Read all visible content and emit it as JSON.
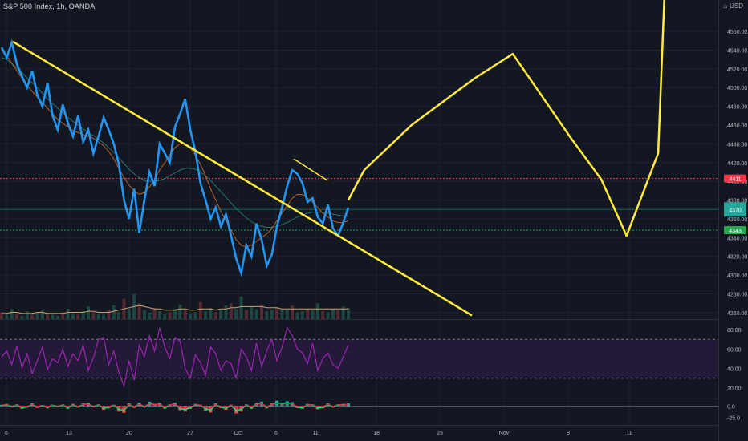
{
  "header": {
    "symbol_title": "S&P 500 Index, 1h, OANDA",
    "currency": "USD"
  },
  "colors": {
    "background": "#131722",
    "grid": "#1e222d",
    "axis_text": "#b2b5be",
    "price_line": "#2196f3",
    "trendline": "#ffeb3b",
    "projection": "#ffeb3b",
    "resistance": "#f23645",
    "support": "#22ab4d",
    "current_price": "#26a69a",
    "rsi_line": "#9c27b0",
    "rsi_band": "#311b4a",
    "volume_ma": "#c8a36a"
  },
  "chart_data": [
    {
      "type": "line",
      "pane": "price",
      "title": "",
      "ylim": [
        4250,
        4590
      ],
      "y_ticks": [
        4260,
        4280,
        4300,
        4320,
        4340,
        4360,
        4380,
        4400,
        4420,
        4440,
        4460,
        4480,
        4500,
        4520,
        4540,
        4560
      ],
      "x_ticks": [
        "6",
        "13",
        "20",
        "27",
        "Oct",
        "6",
        "11",
        "18",
        "25",
        "Nov",
        "8",
        "11"
      ],
      "grid": true,
      "price_labels": [
        {
          "label": "4411",
          "value": 4403,
          "kind": "resistance"
        },
        {
          "label": "4370",
          "value": 4370,
          "kind": "current"
        },
        {
          "label": "4343",
          "value": 4348,
          "kind": "support"
        }
      ],
      "series": [
        {
          "role": "price",
          "values": [
            4543,
            4532,
            4548,
            4525,
            4512,
            4500,
            4518,
            4492,
            4480,
            4505,
            4470,
            4455,
            4482,
            4462,
            4448,
            4470,
            4442,
            4455,
            4430,
            4448,
            4468,
            4455,
            4440,
            4418,
            4380,
            4360,
            4392,
            4345,
            4380,
            4410,
            4395,
            4440,
            4430,
            4420,
            4458,
            4472,
            4488,
            4455,
            4432,
            4398,
            4380,
            4360,
            4372,
            4352,
            4365,
            4342,
            4318,
            4302,
            4332,
            4320,
            4355,
            4338,
            4310,
            4322,
            4352,
            4372,
            4395,
            4412,
            4408,
            4398,
            4378,
            4382,
            4362,
            4355,
            4375,
            4350,
            4342,
            4356,
            4372
          ]
        },
        {
          "role": "ma-fast",
          "values": [
            4540,
            4534,
            4526,
            4518,
            4510,
            4502,
            4496,
            4490,
            4484,
            4478,
            4472,
            4466,
            4462,
            4458,
            4454,
            4452,
            4450,
            4448,
            4446,
            4442,
            4438,
            4432,
            4424,
            4414,
            4404,
            4396,
            4390,
            4386,
            4388,
            4394,
            4402,
            4412,
            4420,
            4428,
            4436,
            4440,
            4440,
            4436,
            4428,
            4418,
            4406,
            4392,
            4380,
            4368,
            4358,
            4348,
            4338,
            4332,
            4330,
            4332,
            4336,
            4340,
            4344,
            4350,
            4358,
            4366,
            4374,
            4382,
            4386,
            4386,
            4382,
            4378,
            4372,
            4366,
            4362,
            4358,
            4356,
            4356,
            4358
          ]
        },
        {
          "role": "ma-slow",
          "values": [
            4532,
            4530,
            4526,
            4521,
            4516,
            4510,
            4505,
            4500,
            4494,
            4488,
            4483,
            4478,
            4473,
            4468,
            4464,
            4460,
            4456,
            4452,
            4449,
            4445,
            4441,
            4436,
            4431,
            4425,
            4419,
            4413,
            4408,
            4404,
            4401,
            4400,
            4400,
            4401,
            4403,
            4406,
            4409,
            4412,
            4414,
            4414,
            4413,
            4410,
            4406,
            4401,
            4395,
            4389,
            4383,
            4377,
            4371,
            4366,
            4361,
            4357,
            4354,
            4352,
            4351,
            4351,
            4352,
            4354,
            4356,
            4359,
            4362,
            4364,
            4366,
            4367,
            4367,
            4367,
            4366,
            4365,
            4364,
            4363,
            4363
          ]
        }
      ]
    },
    {
      "type": "bar",
      "pane": "volume",
      "values": [
        6,
        4,
        9,
        5,
        3,
        7,
        4,
        6,
        8,
        5,
        4,
        3,
        6,
        9,
        5,
        4,
        7,
        11,
        6,
        5,
        4,
        8,
        12,
        6,
        18,
        9,
        22,
        14,
        8,
        6,
        10,
        7,
        5,
        6,
        9,
        13,
        8,
        5,
        6,
        15,
        7,
        10,
        6,
        8,
        12,
        14,
        9,
        20,
        8,
        11,
        9,
        13,
        7,
        8,
        10,
        9,
        8,
        12,
        6,
        7,
        9,
        8,
        14,
        7,
        6,
        9,
        8,
        11,
        10
      ],
      "ma_values": [
        5,
        5,
        6,
        6,
        5,
        5,
        5,
        6,
        6,
        5,
        5,
        5,
        5,
        6,
        6,
        6,
        6,
        7,
        7,
        6,
        6,
        6,
        7,
        8,
        9,
        10,
        11,
        12,
        11,
        10,
        9,
        9,
        8,
        8,
        8,
        9,
        9,
        8,
        8,
        9,
        9,
        9,
        8,
        9,
        9,
        10,
        10,
        11,
        11,
        11,
        11,
        11,
        10,
        10,
        10,
        9,
        9,
        9,
        9,
        9,
        9,
        9,
        9,
        9,
        9,
        9,
        9,
        9,
        9
      ]
    },
    {
      "type": "line",
      "pane": "rsi",
      "ylim": [
        10,
        90
      ],
      "y_ticks": [
        20.0,
        40.0,
        60.0,
        80.0
      ],
      "band": [
        30,
        70
      ],
      "series": [
        {
          "role": "rsi",
          "values": [
            52,
            58,
            44,
            63,
            41,
            55,
            35,
            48,
            62,
            39,
            50,
            46,
            60,
            42,
            55,
            48,
            64,
            38,
            51,
            70,
            72,
            44,
            58,
            36,
            22,
            48,
            28,
            64,
            52,
            74,
            58,
            82,
            62,
            50,
            72,
            68,
            40,
            30,
            54,
            46,
            33,
            62,
            55,
            38,
            48,
            45,
            30,
            60,
            52,
            38,
            66,
            42,
            58,
            70,
            48,
            62,
            82,
            74,
            60,
            56,
            45,
            66,
            38,
            50,
            56,
            44,
            40,
            52,
            64
          ]
        }
      ]
    },
    {
      "type": "bar",
      "pane": "macd",
      "ylim": [
        -40,
        15
      ],
      "y_ticks": [
        0.0,
        -25.0
      ],
      "values": [
        3,
        5,
        -2,
        4,
        -6,
        -3,
        6,
        -4,
        2,
        -5,
        3,
        -2,
        4,
        -6,
        5,
        -3,
        6,
        7,
        -2,
        4,
        -8,
        -5,
        3,
        -12,
        -15,
        6,
        -4,
        8,
        -3,
        10,
        5,
        7,
        -6,
        4,
        8,
        -9,
        -12,
        -6,
        5,
        3,
        -10,
        -14,
        6,
        -4,
        -8,
        3,
        -16,
        -12,
        4,
        -6,
        7,
        10,
        -5,
        6,
        12,
        8,
        11,
        9,
        -4,
        -6,
        5,
        4,
        -7,
        -5,
        6,
        -3,
        4,
        5,
        6
      ]
    }
  ],
  "drawings": {
    "trendline_main": {
      "from": [
        "6",
        4549
      ],
      "to": [
        "Nov",
        4257
      ]
    },
    "trendline_short": {
      "from": [
        "6",
        4424
      ],
      "to": [
        "11",
        4401
      ]
    },
    "projection_path": [
      [
        4380,
        0
      ],
      [
        4412,
        0.05
      ],
      [
        4460,
        0.2
      ],
      [
        4510,
        0.4
      ],
      [
        4536,
        0.52
      ],
      [
        4448,
        0.7
      ],
      [
        4402,
        0.8
      ],
      [
        4342,
        0.88
      ],
      [
        4430,
        0.98
      ],
      [
        4600,
        1.0
      ]
    ]
  }
}
